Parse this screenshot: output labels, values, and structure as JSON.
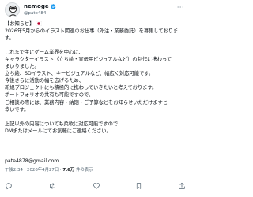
{
  "post": {
    "author_name": "nemoge",
    "author_handle": "@pate484",
    "more_label": "···",
    "body_lines": [
      "【お知らせ】",
      "2026年5月からのイラスト関連のお仕事（外注・業務委託）を募集しておりま",
      "す。",
      "",
      "これまで主にゲーム業界を中心に、",
      "キャラクターイラスト（立ち絵・宣伝用ビジュアルなど）の制作に携わって",
      "まいりました。",
      "立ち絵、SDイラスト、キービジュアルなど、幅広く対応可能です。",
      "今後さらに活動の幅を広げるため、",
      "新規プロジェクトにも積極的に携わっていきたいと考えております。",
      "ポートフォリオの共有も可能ですので、",
      "ご相談の際には、業務内容・納期・ご予算などをお知らせいただけますと",
      "幸いです。",
      "",
      "上記以外の内容についても柔軟に対応可能ですので、",
      "DMまたはメールにてお気軽にご連絡ください。"
    ],
    "email": "pate4878@gmail.com",
    "timestamp": "午後2:34 · 2026年4月27日 · ",
    "views_count": "7.6万",
    "views_label": " 件の表示"
  },
  "actions": {
    "reply_count": "",
    "repost_count": "",
    "like_count": "",
    "bookmark_count": ""
  },
  "colors": {
    "text": "#0f1419",
    "muted": "#536471",
    "divider": "#eff3f4"
  }
}
